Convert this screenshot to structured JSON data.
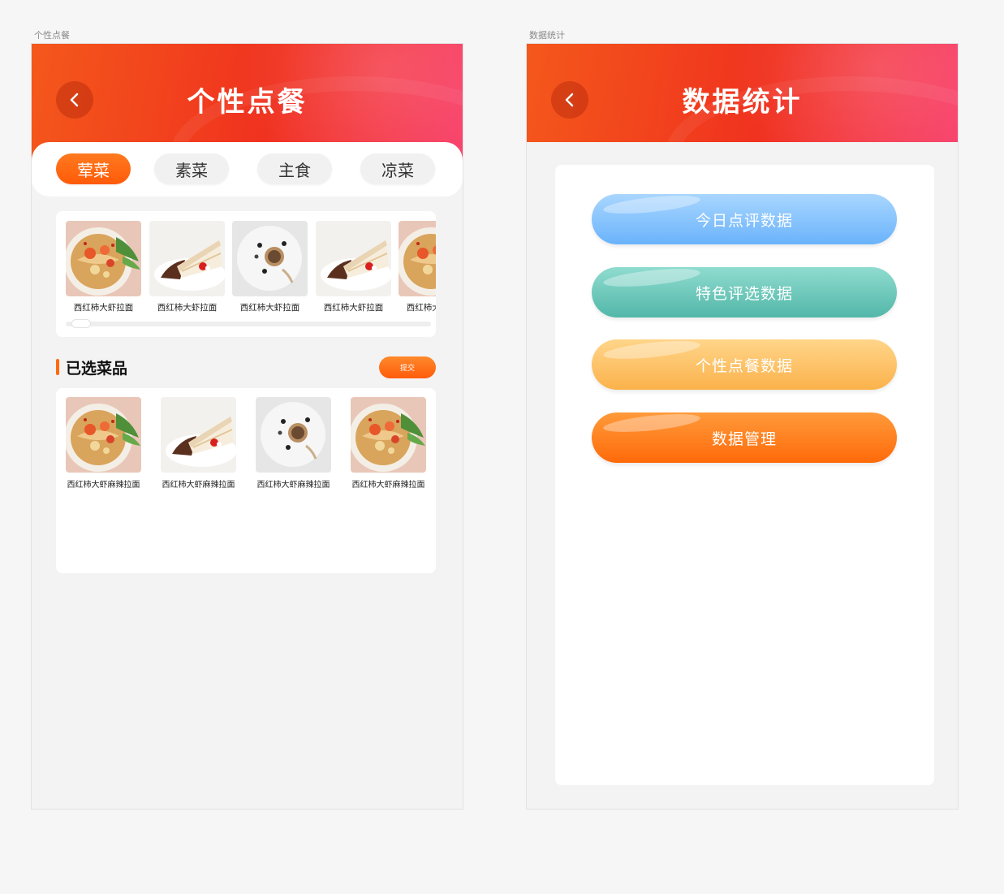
{
  "frames": {
    "left_label": "个性点餐",
    "right_label": "数据统计"
  },
  "left": {
    "title": "个性点餐",
    "tabs": [
      "荤菜",
      "素菜",
      "主食",
      "凉菜"
    ],
    "active_tab": "荤菜",
    "menu_items": [
      {
        "caption": "西红柿大虾拉面",
        "image": "noodle-bowl"
      },
      {
        "caption": "西红柿大虾拉面",
        "image": "cake-slice"
      },
      {
        "caption": "西红柿大虾拉面",
        "image": "plated-dessert"
      },
      {
        "caption": "西红柿大虾拉面",
        "image": "cake-slice"
      },
      {
        "caption": "西红柿大虾拉面",
        "image": "noodle-bowl"
      }
    ],
    "selected_section_title": "已选菜品",
    "submit_label": "提交",
    "selected_items": [
      {
        "caption": "西红柿大虾麻辣拉面",
        "image": "noodle-bowl"
      },
      {
        "caption": "西红柿大虾麻辣拉面",
        "image": "cake-slice"
      },
      {
        "caption": "西红柿大虾麻辣拉面",
        "image": "plated-dessert"
      },
      {
        "caption": "西红柿大虾麻辣拉面",
        "image": "noodle-bowl"
      }
    ]
  },
  "right": {
    "title": "数据统计",
    "buttons": [
      {
        "label": "今日点评数据",
        "color_top": "#a9d6ff",
        "color_bottom": "#6ab3fb"
      },
      {
        "label": "特色评选数据",
        "color_top": "#8fdccf",
        "color_bottom": "#52b7a9"
      },
      {
        "label": "个性点餐数据",
        "color_top": "#ffd58a",
        "color_bottom": "#fbb24b"
      },
      {
        "label": "数据管理",
        "color_top": "#ff9a3a",
        "color_bottom": "#ff6a0a"
      }
    ]
  },
  "colors": {
    "accent": "#ff6a10",
    "hero_start": "#f4581b",
    "hero_end": "#f8406a"
  }
}
